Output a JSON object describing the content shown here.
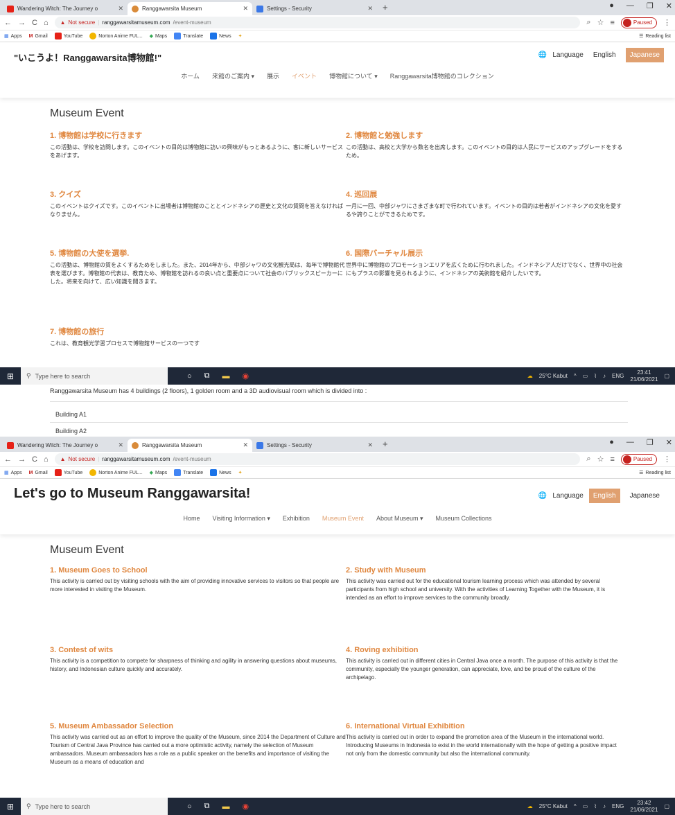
{
  "browser": {
    "tabs": [
      {
        "title": "Wandering Witch: The Journey o",
        "favicon": "youtube-icon",
        "color": "#e62117"
      },
      {
        "title": "Ranggawarsita Museum",
        "favicon": "museum-favicon",
        "color": "#d98b3a"
      },
      {
        "title": "Settings - Security",
        "favicon": "gear-icon",
        "color": "#3b78e7"
      }
    ],
    "not_secure": "Not secure",
    "url_host": "ranggawarsitamuseum.com",
    "url_path": "/event-museum",
    "profile": "Paused",
    "bookmarks": [
      "Apps",
      "Gmail",
      "YouTube",
      "Norton Anime FUL...",
      "Maps",
      "Translate",
      "News"
    ],
    "reading_list": "Reading list"
  },
  "lang": {
    "label": "Language",
    "english": "English",
    "japanese": "Japanese"
  },
  "jp": {
    "brand": "\"いこうよ！Ranggawarsita博物館!\"",
    "nav": [
      "ホーム",
      "来館のご案内 ▾",
      "展示",
      "イベント",
      "博物館について ▾",
      "Ranggawarsita博物館のコレクション"
    ],
    "title": "Museum Event",
    "events": [
      {
        "h": "1. 博物館は学校に行きます",
        "p": "この活動は、学校を訪問します。このイベントの目的は博物館に訪いの興味がもっとあるように、客に新しいサービスをあげます。"
      },
      {
        "h": "2. 博物館と勉強します",
        "p": "この活動は、高校と大学から数名を出席します。このイベントの目的は人民にサービスのアップグレードをするため。"
      },
      {
        "h": "3. クイズ",
        "p": "このイベントはクイズです。このイベントに出場者は博物館のこととインドネシアの歴史と文化の質問を答えなければなりません。"
      },
      {
        "h": "4. 巡回展",
        "p": "一月に一回、中部ジャワにさまざまな町で行われています。イベントの目的は若者がインドネシアの文化を愛するや誇りことができるためです。"
      },
      {
        "h": "5. 博物館の大使を選挙.",
        "p": "この活動は、博物館の質をよくするためをしました。また、2014年から、中部ジャワの文化観光局は、毎年で博物館代表を選びます。博物館の代表は、教育ため、博物館を訪れるの良い点と重要点について社会のパブリックスピーカーにした。将来を向けて、広い知識を聞きます。"
      },
      {
        "h": "6. 国際バーチャル展示",
        "p": "世界中に博物館のプロモーションエリアを広くために行われました。インドネシア人だけでなく、世界中の社会にもプラスの影響を見られるように、インドネシアの美術館を紹介したいです。"
      },
      {
        "h": "7. 博物館の旅行",
        "p": "これは、教育観光学習プロセスで博物館サービスの一つです"
      }
    ]
  },
  "middle": {
    "intro": "Ranggawarsita Museum has 4 buildings (2 floors), 1 golden room and a 3D audiovisual room which is divided into :",
    "buildings": [
      "Building A1",
      "Building A2"
    ]
  },
  "en": {
    "brand": "Let's go to Museum Ranggawarsita!",
    "nav": [
      "Home",
      "Visiting Information ▾",
      "Exhibition",
      "Museum Event",
      "About Museum ▾",
      "Museum Collections"
    ],
    "title": "Museum Event",
    "events": [
      {
        "h": "1. Museum Goes to School",
        "p": "This activity is carried out by visiting schools with the aim of providing innovative services to visitors so that people are more interested in visiting the Museum."
      },
      {
        "h": "2. Study with Museum",
        "p": "This activity was carried out for the educational tourism learning process which was attended by several participants from high school and university. With the activities of Learning Together with the Museum, it is intended as an effort to improve services to the community broadly."
      },
      {
        "h": "3. Contest of wits",
        "p": "This activity is a competition to compete for sharpness of thinking and agility in answering questions about museums, history, and Indonesian culture quickly and accurately."
      },
      {
        "h": "4. Roving exhibition",
        "p": "This activity is carried out in different cities in Central Java once a month. The purpose of this activity is that the community, especially the younger generation, can appreciate, love, and be proud of the culture of the archipelago."
      },
      {
        "h": "5. Museum Ambassador Selection",
        "p": "This activity was carried out as an effort to improve the quality of the Museum, since 2014 the Department of Culture and Tourism of Central Java Province has carried out a more optimistic activity, namely the selection of Museum ambassadors. Museum ambassadors has a role as a public speaker on the benefits and importance of visiting the Museum as a means of education and"
      },
      {
        "h": "6. International Virtual Exhibition",
        "p": "This activity is carried out in order to expand the promotion area of the Museum in the international world. Introducing Museums in Indonesia to exist in the world internationally with the hope of getting a positive impact not only from the domestic community but also the international community."
      }
    ]
  },
  "taskbar": {
    "search": "Type here to search",
    "weather": "25°C Kabut",
    "lang": "ENG",
    "time1": "23:41",
    "date1": "21/06/2021",
    "time2": "23:42",
    "date2": "21/06/2021"
  },
  "colors": {
    "accent": "#e0873f",
    "taskbar": "#1f2838"
  }
}
